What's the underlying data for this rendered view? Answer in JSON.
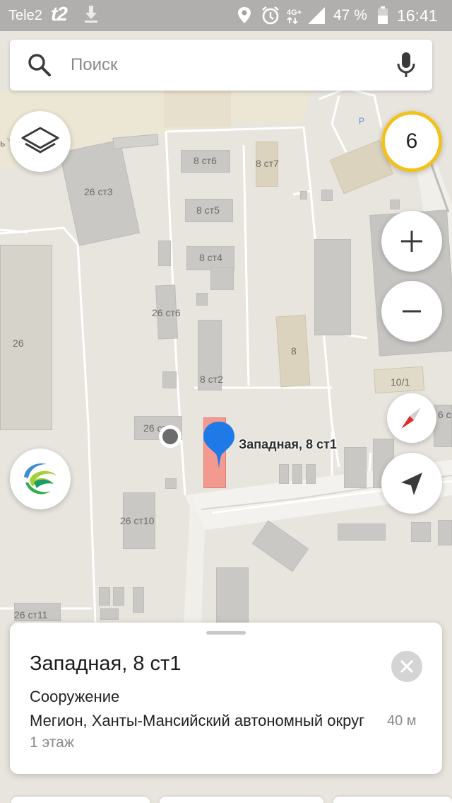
{
  "status_bar": {
    "carrier": "Tele2",
    "carrier_logo": "t2",
    "network": "4G+",
    "battery": "47 %",
    "time": "16:41",
    "icons": [
      "download-icon",
      "location-icon",
      "alarm-icon",
      "network-4g-icon",
      "signal-icon",
      "battery-icon"
    ]
  },
  "search": {
    "placeholder": "Поиск",
    "value": ""
  },
  "traffic": {
    "level": "6",
    "color": "#f3c21a"
  },
  "map": {
    "labels": [
      "8 ст6",
      "8 ст7",
      "26 ст3",
      "8 ст5",
      "8 ст4",
      "26 ст6",
      "26",
      "8",
      "8 ст2",
      "10/1",
      "6 с",
      "26 ст",
      "26 ст10",
      "26 ст11",
      "ь"
    ],
    "parking_label": "P",
    "selected_pin_label": "Западная, 8 ст1",
    "colors": {
      "pin": "#1f7ae8",
      "selected_building": "#f29a8f"
    }
  },
  "card": {
    "title": "Западная, 8 ст1",
    "type": "Сооружение",
    "address": "Мегион, Ханты-Мансийский автономный округ",
    "distance": "40 м",
    "floors": "1 этаж"
  }
}
